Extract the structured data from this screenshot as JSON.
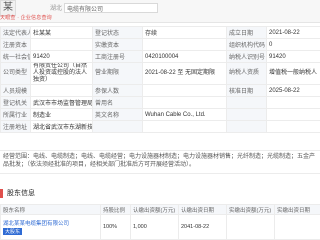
{
  "header": {
    "logo_glyph": "某",
    "brand_text": "天眼查 · 企业信息查询",
    "search_location": "湖北",
    "search_value": "电缆有限公司"
  },
  "info_rows": [
    {
      "l1": "法定代表人",
      "v1": "杜某某",
      "l2": "登记状态",
      "v2": "存续",
      "l3": "成立日期",
      "v3": "2021-08-22"
    },
    {
      "l1": "注册资本",
      "v1": "",
      "l2": "实缴资本",
      "v2": "",
      "l3": "组织机构代码",
      "v3": "0"
    },
    {
      "l1": "统一社会信用代码",
      "v1": "91420",
      " l2": "",
      "l2": "工商注册号",
      "v2": "0420100004",
      "l3": "纳税人识别号",
      "v3": "91420"
    },
    {
      "l1": "公司类型",
      "v1": "有限责任公司（自然人投资或控股的法人独资）",
      "l2": "营业期限",
      "v2": "2021-08-22 至 无固定期限",
      "l3": "纳税人资质",
      "v3": "增值税一般纳税人"
    },
    {
      "l1": "人员规模",
      "v1": "",
      "l2": "参保人数",
      "v2": "",
      "l3": "核准日期",
      "v3": "2025-08-22"
    },
    {
      "l1": "登记机关",
      "v1": "武汉市市场监督管理局",
      "l2": "曾用名",
      "v2": "",
      "l3": "",
      "v3": ""
    },
    {
      "l1": "所属行业",
      "v1": "制造业",
      "l2": "英文名称",
      "v2": "Wuhan Cable Co., Ltd.",
      "l3": "",
      "v3": ""
    },
    {
      "l1": "注册地址",
      "v1": "湖北省武汉市东湖新技术开发区光谷大道某号",
      "l2": "",
      "v2": "",
      "l3": "",
      "v3": ""
    }
  ],
  "scope": {
    "text": "经营范围：电线、电缆制造；电线、电缆经营；电力设施器材制造；电力设施器材销售；光纤制造；光缆制造；五金产品批发；（依法须经批准的项目，经相关部门批准后方可开展经营活动）。"
  },
  "financing": {
    "title": "股东信息",
    "headers": [
      "股东名称",
      "持股比例",
      "认缴出资额(万元)",
      "认缴出资日期",
      "实缴出资额(万元)",
      "实缴出资日期"
    ],
    "row": {
      "name": "湖北某某电缆集团有限公司",
      "badge": "大股东",
      "ratio": "100%",
      "subscribed": "1,000",
      "sub_date": "2041-08-22",
      "paid": "",
      "paid_date": ""
    }
  }
}
